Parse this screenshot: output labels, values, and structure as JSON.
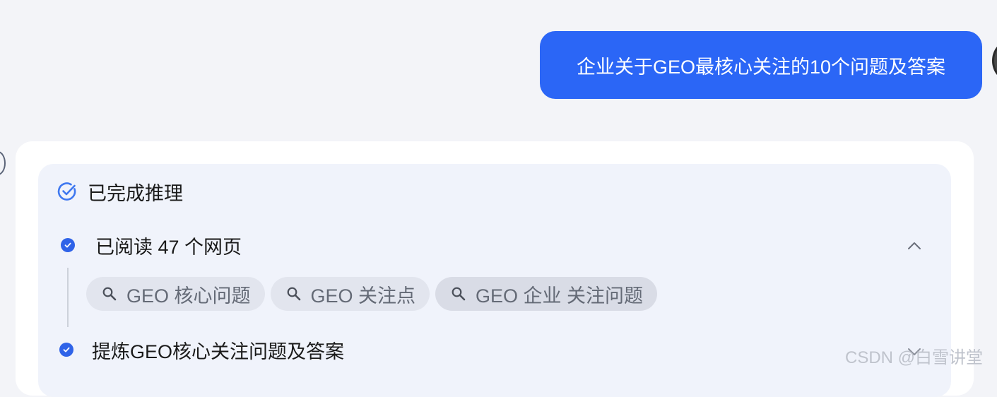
{
  "conversation": {
    "user_message": "企业关于GEO最核心关注的10个问题及答案"
  },
  "reasoning": {
    "title": "已完成推理",
    "steps": [
      {
        "label": "已阅读 47 个网页",
        "search_queries": [
          "GEO 核心问题",
          "GEO 关注点",
          "GEO 企业 关注问题"
        ]
      },
      {
        "label": "提炼GEO核心关注问题及答案"
      }
    ]
  },
  "watermark": "CSDN @白雪讲堂",
  "colors": {
    "accent": "#2b66f6",
    "step_check": "#2f63e8",
    "chip_bg": "#e2e5ee",
    "page_bg": "#f3f4f8"
  },
  "icons": {
    "reasoning_done": "check-circle-icon",
    "step_done": "step-check-icon",
    "query": "search-icon",
    "collapse": "chevron-up-icon"
  }
}
